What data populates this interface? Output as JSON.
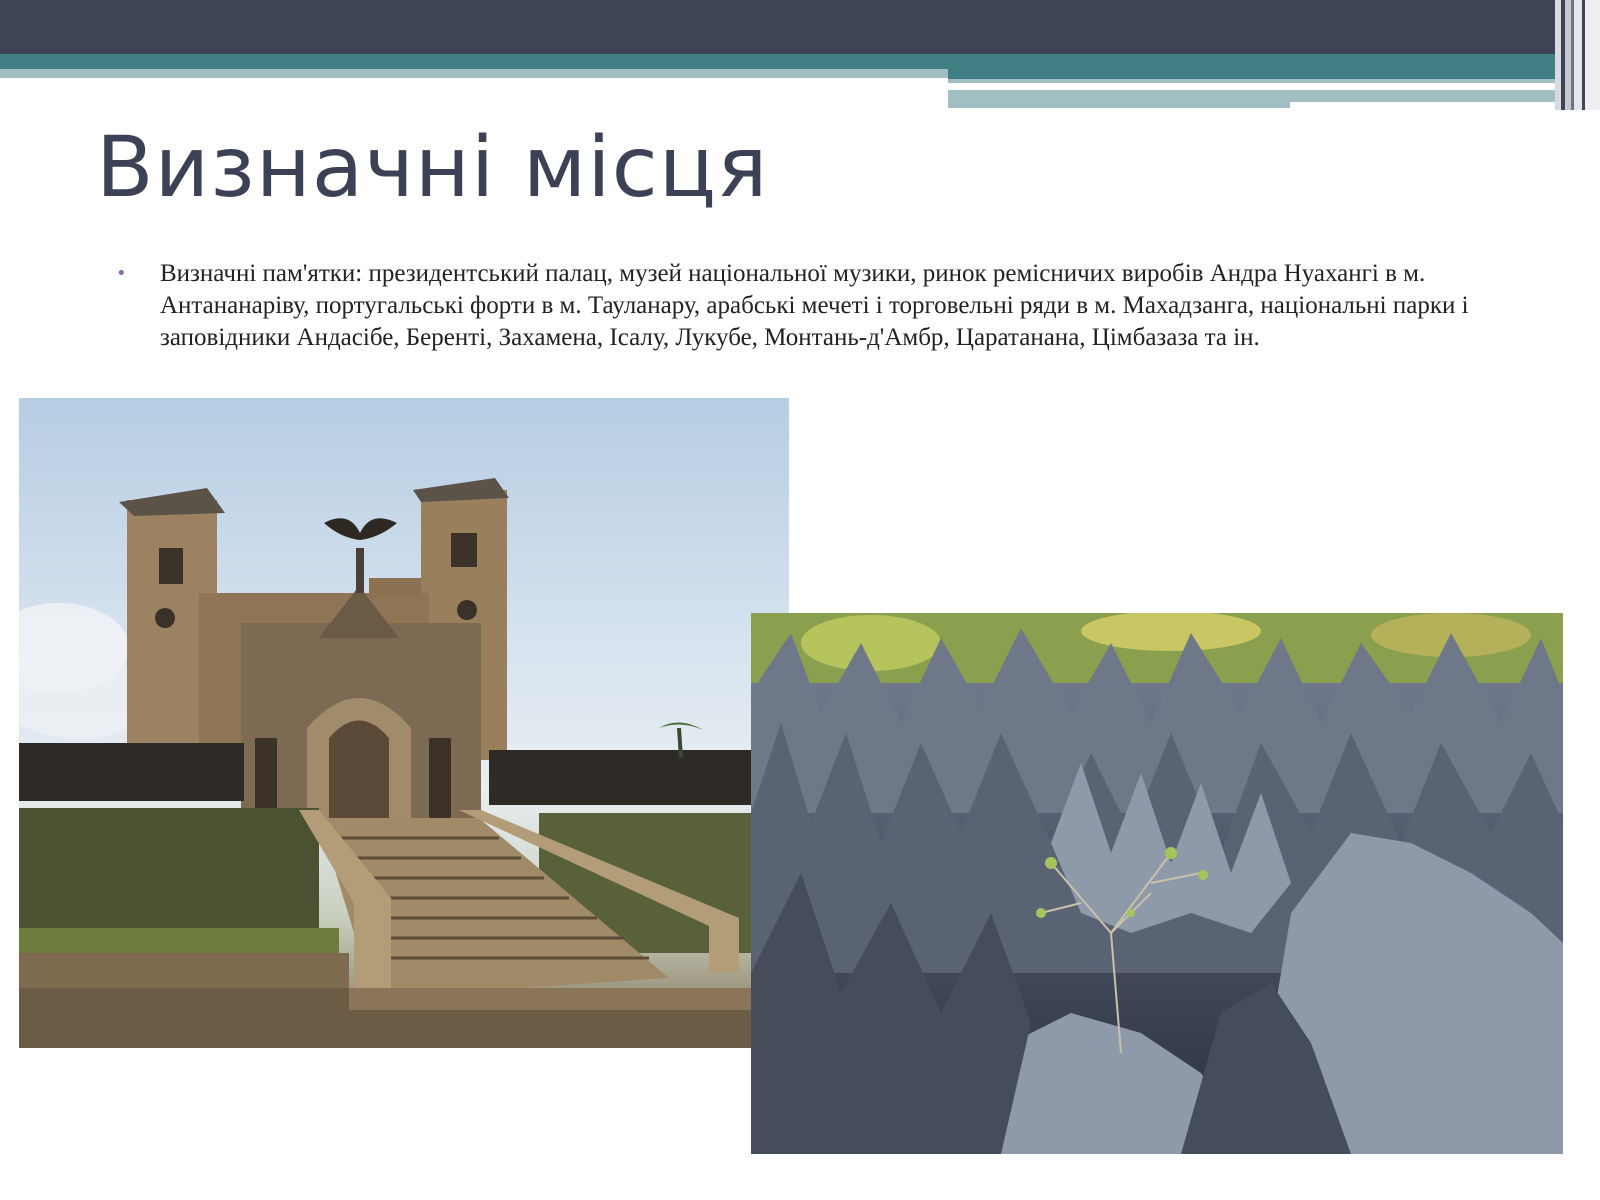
{
  "slide": {
    "title": "Визначні місця",
    "bullet_text": "Визначні пам'ятки: президентський палац, музей національної музики, ринок ремісничих виробів Андра Нуахангі в м. Антананаріву, португальські форти в м. Тауланару, арабські мечеті і торговельні ряди в м. Махадзанга, національні парки і заповідники Андасібе, Беренті, Захамена, Ісалу, Лукубе, Монтань-д'Амбр, Царатанана, Цімбазаза та ін."
  },
  "images": [
    {
      "name": "palace-photo"
    },
    {
      "name": "tsingy-photo"
    }
  ],
  "colors": {
    "header_dark": "#3f4356",
    "header_teal": "#3f7e83",
    "header_light": "#a2bfc3",
    "title": "#3d4155",
    "bullet": "#8d6aa8"
  }
}
